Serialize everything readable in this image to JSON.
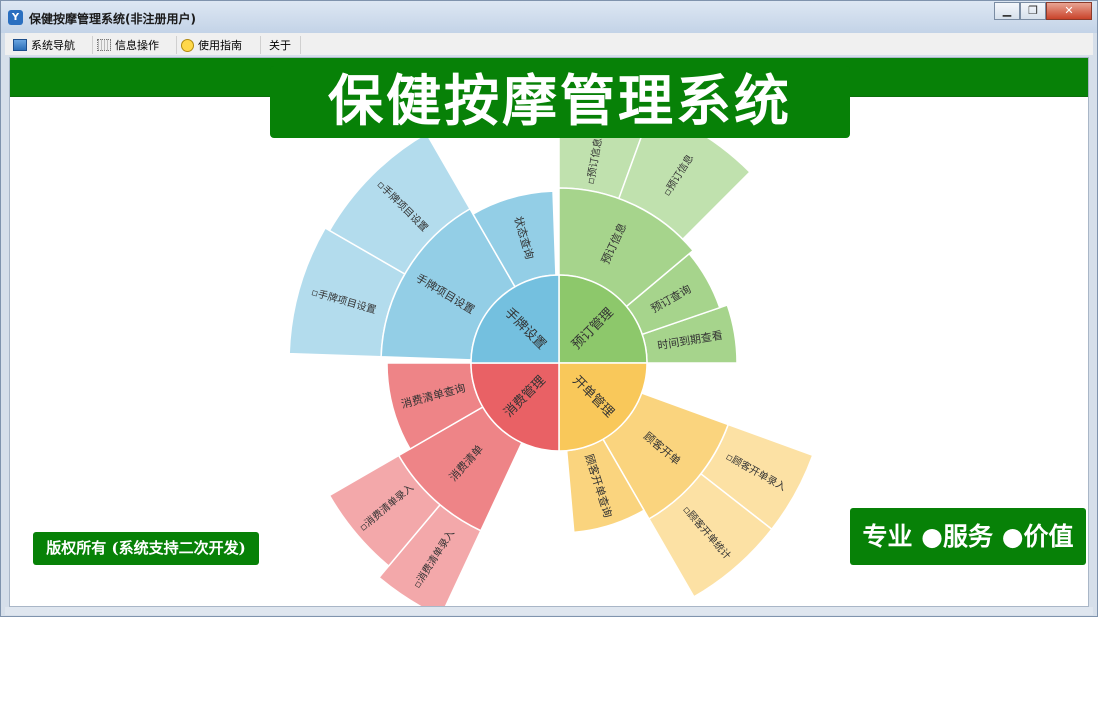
{
  "window": {
    "title": "保健按摩管理系统(非注册用户)",
    "icon": "app-logo-icon",
    "controls": {
      "minimize": "minimize-icon",
      "restore": "restore-icon",
      "close": "close-icon"
    }
  },
  "menu": [
    {
      "label": "系统导航",
      "icon": "monitor-icon"
    },
    {
      "label": "信息操作",
      "icon": "grid-icon"
    },
    {
      "label": "使用指南",
      "icon": "smiley-icon"
    },
    {
      "label": "关于",
      "icon": ""
    }
  ],
  "banner": {
    "title": "保健按摩管理系统"
  },
  "copyright": "版权所有 (系统支持二次开发)",
  "slogan": "专业 ●服务 ●价值",
  "sunburst": {
    "center_items": [
      "预订管理",
      "开单管理",
      "消费管理",
      "手牌设置"
    ],
    "colors": {
      "预订管理": "#8dc86b",
      "开单管理": "#f9c85a",
      "消费管理": "#e96165",
      "手牌设置": "#74c0df"
    },
    "children": {
      "预订管理": [
        "时间到期查看",
        "预订查询",
        "预订信息"
      ],
      "开单管理": [
        "顾客开单",
        "顾客开单查询"
      ],
      "消费管理": [
        "消费清单",
        "消费清单查询"
      ],
      "手牌设置": [
        "手牌项目设置",
        "状态查询"
      ]
    },
    "leaves": {
      "预订信息": [
        "▫预订信息统计",
        "▫预订信息"
      ],
      "顾客开单": [
        "▫顾客开单录入",
        "▫顾客开单统计"
      ],
      "消费清单": [
        "▫消费清单录入",
        "▫消费清单录入"
      ],
      "手牌项目设置": [
        "▫手牌项目设置",
        "▫手牌项目设置"
      ]
    }
  }
}
